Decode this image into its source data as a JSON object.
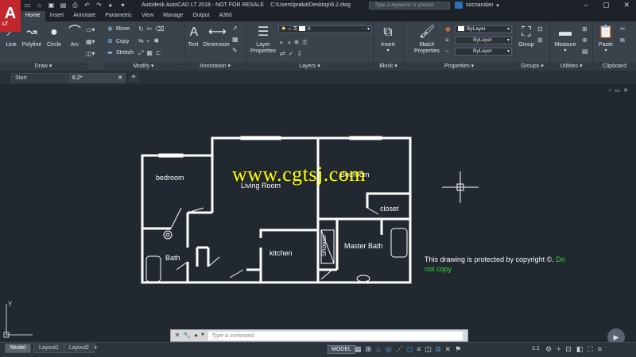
{
  "window": {
    "title": "Autodesk AutoCAD LT 2018 - NOT FOR RESALE",
    "file_path": "C:\\Users\\praka\\Desktop\\6.2.dwg",
    "logo_text": "A",
    "logo_sub": "LT",
    "search_placeholder": "Type a keyword or phrase",
    "user_name": "socnandan",
    "controls": [
      "–",
      "▢",
      "✕"
    ]
  },
  "ribbon": {
    "tabs": [
      "Home",
      "Insert",
      "Annotate",
      "Parametric",
      "View",
      "Manage",
      "Output",
      "A360"
    ],
    "panels": {
      "draw": {
        "label": "Draw",
        "tools": [
          "Line",
          "Polyline",
          "Circle",
          "Arc"
        ]
      },
      "modify": {
        "label": "Modify",
        "tools": [
          "Move",
          "Copy",
          "Stretch"
        ]
      },
      "annotation": {
        "label": "Annotation",
        "tools": [
          "Text",
          "Dimension"
        ]
      },
      "layers": {
        "label": "Layers",
        "tool": "Layer Properties",
        "layer_value": "0"
      },
      "block": {
        "label": "Block",
        "tool": "Insert"
      },
      "properties": {
        "label": "Properties",
        "tool": "Match Properties",
        "values": [
          "ByLayer",
          "ByLayer",
          "ByLayer"
        ]
      },
      "groups": {
        "label": "Groups",
        "tool": "Group"
      },
      "utilities": {
        "label": "Utilities",
        "tool": "Measure"
      },
      "clipboard": {
        "label": "Clipboard",
        "tool": "Paste"
      }
    }
  },
  "file_tabs": [
    {
      "label": "Start"
    },
    {
      "label": "6.2*"
    }
  ],
  "drawing": {
    "rooms": {
      "bedroom": "bedroom",
      "living_room": "Living Room",
      "bedroom2": "Bedroom",
      "closet": "closet",
      "bath": "Bath",
      "kitchen": "kitchen",
      "shower": "Shower",
      "master_bath": "Master Bath"
    },
    "watermark": "www.cgtsj.com",
    "copyright_white": "This drawing is protected by copyright ©.",
    "copyright_green": "Do not copy",
    "ucs_y": "Y"
  },
  "command_line": {
    "placeholder": "Type a command"
  },
  "status": {
    "layout_tabs": [
      "Model",
      "Layout1",
      "Layout2"
    ],
    "model_button": "MODEL",
    "scale": "1:1"
  },
  "colors": {
    "wall": "#ffffff",
    "watermark": "#ffff00",
    "copyright_green": "#33dd33",
    "background": "#212830"
  }
}
